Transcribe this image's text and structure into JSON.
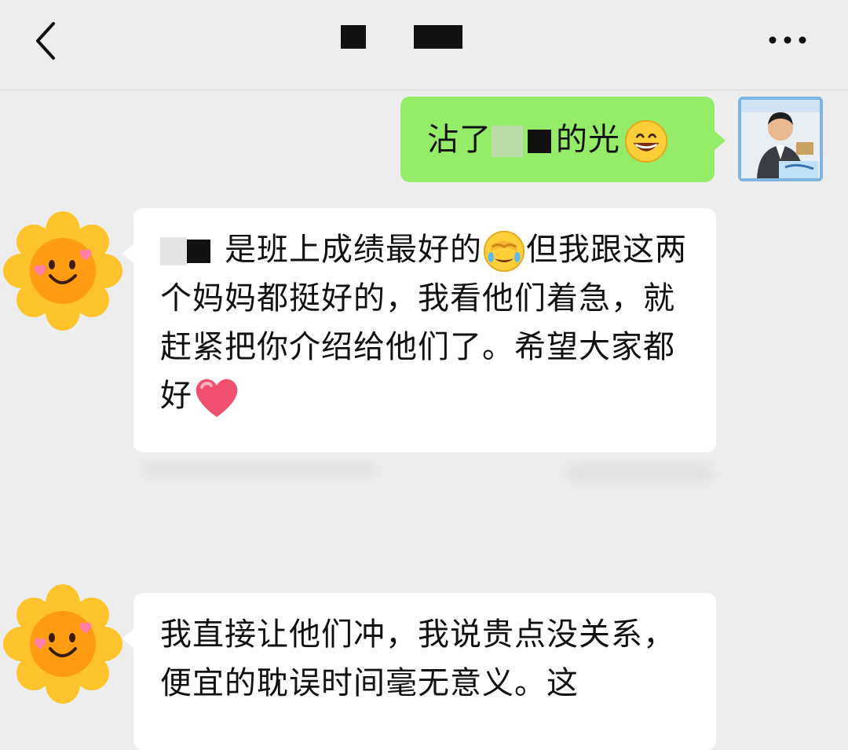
{
  "header": {
    "title": "■ ■■■",
    "back_icon": "chevron-left-icon",
    "more_icon": "more-dots-icon"
  },
  "messages": [
    {
      "sender": "me",
      "parts": [
        "沾了",
        "的光"
      ],
      "emoji": "grinning-face"
    },
    {
      "sender": "contact",
      "segments": [
        "是班上成绩最好的",
        "但我跟这两个妈妈都挺好的，我看他们着急，就赶紧把你介绍给他们了。希望大家都好"
      ],
      "emojis": [
        "facepalm-face",
        "red-heart"
      ]
    },
    {
      "sender": "contact",
      "text": "我直接让他们冲，我说贵点没关系，便宜的耽误时间毫无意义。这"
    }
  ],
  "colors": {
    "background": "#ededed",
    "my_bubble": "#95ec69",
    "their_bubble": "#ffffff",
    "sun_petal": "#ffc42b",
    "sun_face": "#ff9c12"
  }
}
